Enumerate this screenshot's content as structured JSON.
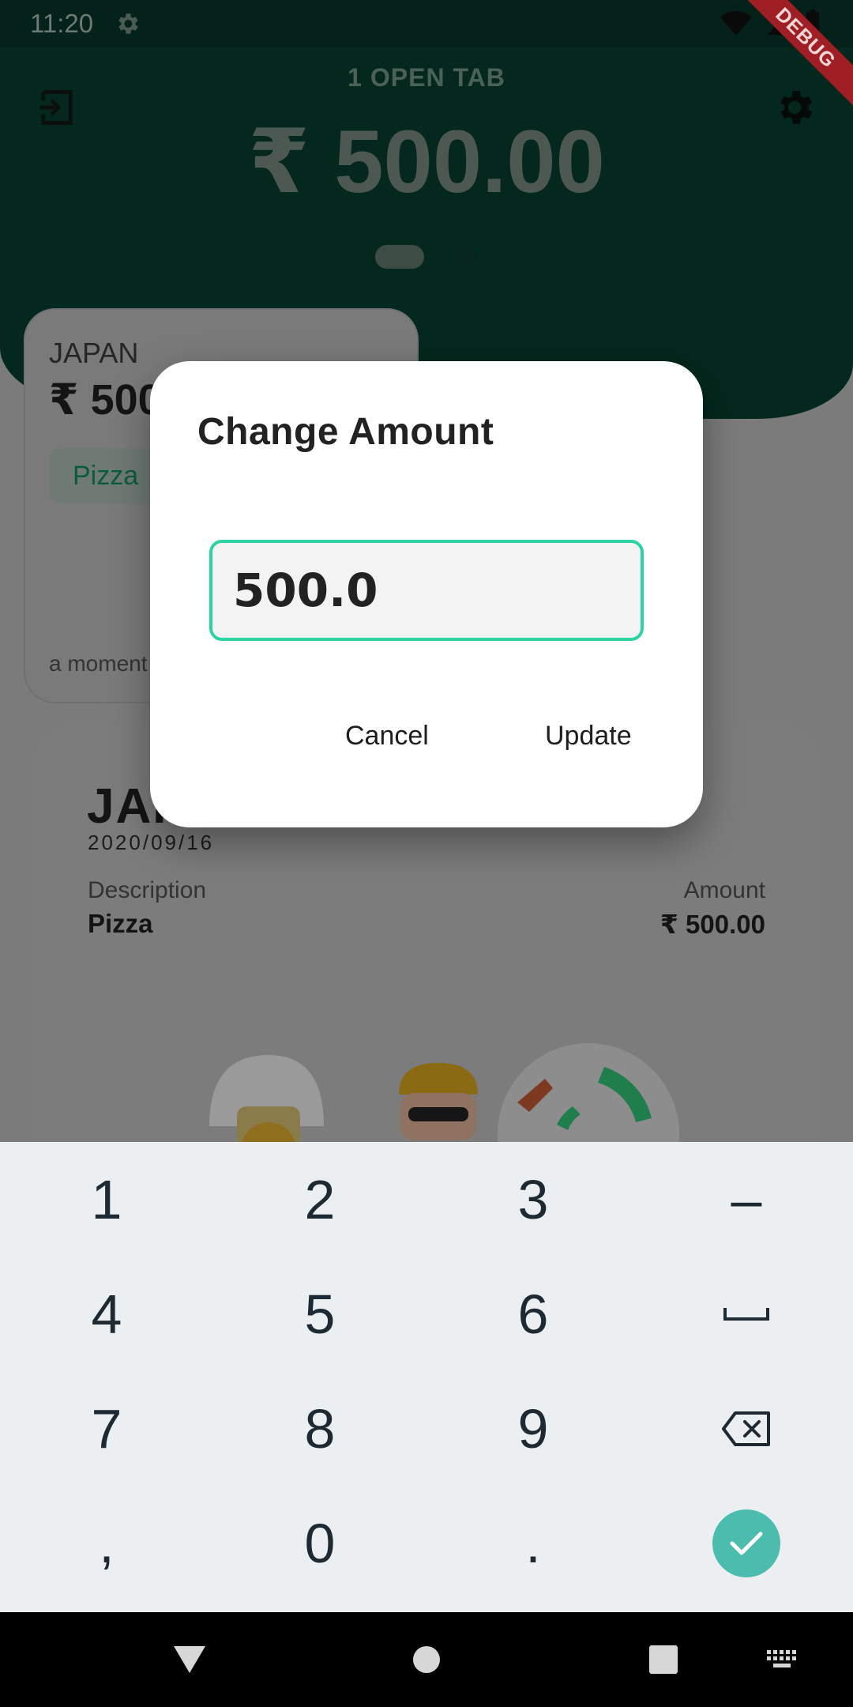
{
  "status_bar": {
    "time": "11:20"
  },
  "debug_banner": "DEBUG",
  "header": {
    "open_tabs_label": "1 OPEN TAB",
    "total": "₹ 500.00"
  },
  "tab_card": {
    "name": "JAPAN",
    "amount": "₹ 500.00",
    "chip_label": "Pizza",
    "time_ago": "a moment ago"
  },
  "receipt": {
    "name": "JAPAN",
    "date": "2020/09/16",
    "description_label": "Description",
    "description_value": "Pizza",
    "amount_label": "Amount",
    "amount_value": "₹ 500.00"
  },
  "dialog": {
    "title": "Change Amount",
    "input_value": "500.0",
    "cancel_label": "Cancel",
    "update_label": "Update"
  },
  "keyboard": {
    "rows": [
      [
        "1",
        "2",
        "3",
        "–"
      ],
      [
        "4",
        "5",
        "6",
        "space-icon"
      ],
      [
        "7",
        "8",
        "9",
        "backspace-icon"
      ],
      [
        ",",
        "0",
        ".",
        "done-check-icon"
      ]
    ]
  },
  "colors": {
    "accent": "#2ed3a4",
    "done_key": "#4bbcad",
    "header_bg": "#04281d"
  }
}
